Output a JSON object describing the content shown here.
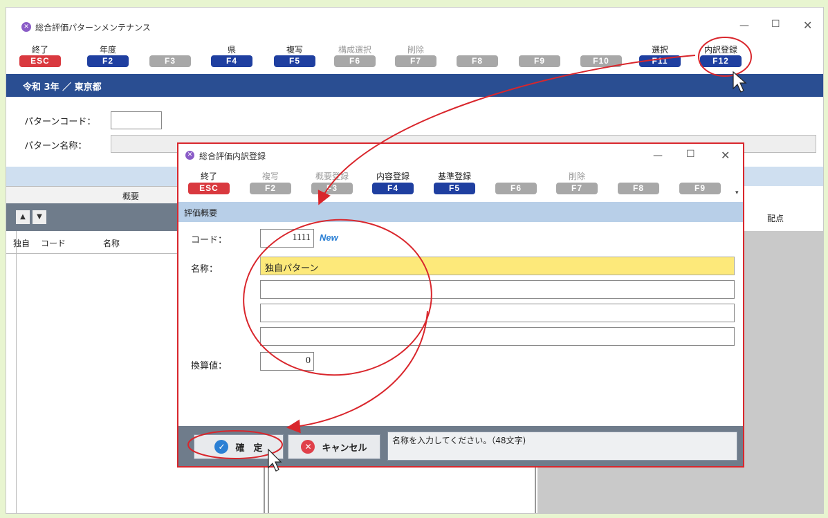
{
  "main_window": {
    "title": "総合評価パターンメンテナンス",
    "fkeys": [
      {
        "label": "終了",
        "key": "ESC",
        "style": "esc"
      },
      {
        "label": "年度",
        "key": "F2",
        "style": "blue"
      },
      {
        "label": "",
        "key": "F3",
        "style": "gray"
      },
      {
        "label": "県",
        "key": "F4",
        "style": "blue"
      },
      {
        "label": "複写",
        "key": "F5",
        "style": "blue"
      },
      {
        "label": "構成選択",
        "key": "F6",
        "style": "gray"
      },
      {
        "label": "削除",
        "key": "F7",
        "style": "gray"
      },
      {
        "label": "",
        "key": "F8",
        "style": "gray"
      },
      {
        "label": "",
        "key": "F9",
        "style": "gray"
      },
      {
        "label": "",
        "key": "F10",
        "style": "gray"
      },
      {
        "label": "選択",
        "key": "F11",
        "style": "blue"
      },
      {
        "label": "内訳登録",
        "key": "F12",
        "style": "blue"
      }
    ],
    "nav_text": "令和 3年 ／ 東京都",
    "pattern_code_label": "パターンコード：",
    "pattern_code_value": "",
    "pattern_name_label": "パターン名称：",
    "pattern_name_value": "",
    "left_table": {
      "section_header": "概要",
      "columns": [
        "独自",
        "コード",
        "名称"
      ]
    },
    "right_table": {
      "columns": [
        "配点"
      ]
    }
  },
  "dialog": {
    "title": "総合評価内訳登録",
    "fkeys": [
      {
        "label": "終了",
        "key": "ESC",
        "style": "esc"
      },
      {
        "label": "複写",
        "key": "F2",
        "style": "gray"
      },
      {
        "label": "概要登録",
        "key": "F3",
        "style": "gray"
      },
      {
        "label": "内容登録",
        "key": "F4",
        "style": "blue"
      },
      {
        "label": "基準登録",
        "key": "F5",
        "style": "blue"
      },
      {
        "label": "",
        "key": "F6",
        "style": "gray"
      },
      {
        "label": "削除",
        "key": "F7",
        "style": "gray"
      },
      {
        "label": "",
        "key": "F8",
        "style": "gray"
      },
      {
        "label": "",
        "key": "F9",
        "style": "gray"
      }
    ],
    "section_title": "評価概要",
    "code_label": "コード：",
    "code_value": "1111",
    "code_badge": "New",
    "name_label": "名称：",
    "name_values": [
      "独自パターン",
      "",
      "",
      ""
    ],
    "conversion_label": "換算値：",
    "conversion_value": "0",
    "confirm_button": "確　定",
    "cancel_button": "キャンセル",
    "status_message": "名称を入力してください。（48文字)"
  },
  "colors": {
    "esc": "#d9393f",
    "fkey_blue": "#1f3fa0",
    "fkey_gray": "#a8a8a8",
    "nav_band": "#2a4e92",
    "highlight": "#fde97a",
    "annotation": "#d9262c",
    "badge": "#2a7fd4"
  }
}
